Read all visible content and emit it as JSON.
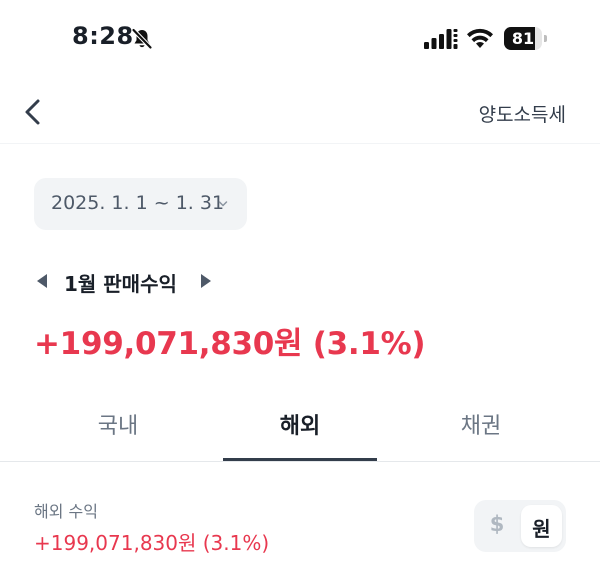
{
  "status_bar": {
    "time": "8:28",
    "battery_text": "81",
    "battery_level": 0.81,
    "icons": [
      "bell-slash-icon",
      "cellular-signal-icon",
      "wifi-icon",
      "battery-icon"
    ]
  },
  "nav": {
    "back_icon": "chevron-left-icon",
    "right_label": "양도소득세"
  },
  "filter": {
    "date_range": "2025. 1. 1 ~ 1. 31",
    "chevron_icon": "chevron-down-icon"
  },
  "summary": {
    "month_label": "1월 판매수익",
    "profit": "+199,071,830원 (3.1%)"
  },
  "tabs": [
    {
      "label": "국내",
      "active": false
    },
    {
      "label": "해외",
      "active": true
    },
    {
      "label": "채권",
      "active": false
    }
  ],
  "overseas": {
    "label": "해외 수익",
    "value": "+199,071,830원 (3.1%)"
  },
  "currency_toggle": {
    "dollar": "$",
    "won": "원",
    "selected": "원"
  },
  "colors": {
    "profit_red": "#e8384f",
    "text_primary": "#191f28",
    "text_secondary": "#6b7684",
    "chip_bg": "#f2f4f6"
  }
}
